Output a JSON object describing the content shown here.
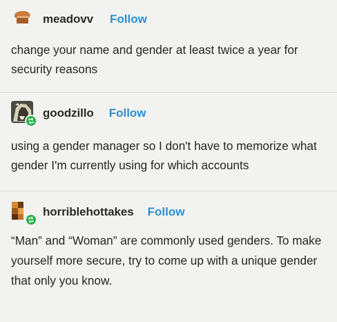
{
  "posts": [
    {
      "username": "meadovv",
      "follow_label": "Follow",
      "text": "change your name and gender at least twice a year for security reasons",
      "avatar_icon": "bread-loaf-icon"
    },
    {
      "username": "goodzillo",
      "follow_label": "Follow",
      "text": "using a gender manager so I don't have to memorize what gender I'm currently using for which accounts",
      "avatar_icon": "goodzillo-avatar",
      "reblog_icon": "reblog-icon"
    },
    {
      "username": "horriblehottakes",
      "follow_label": "Follow",
      "text": "“Man” and “Woman” are commonly used genders. To make yourself more secure, try to come up with a unique gender that only you know.",
      "avatar_icon": "horriblehottakes-avatar",
      "reblog_icon": "reblog-icon"
    }
  ],
  "colors": {
    "background": "#f2f2f0",
    "follow": "#2c8fd0",
    "reblog": "#25b34a",
    "divider": "#d8d8d4",
    "text": "#252525"
  }
}
